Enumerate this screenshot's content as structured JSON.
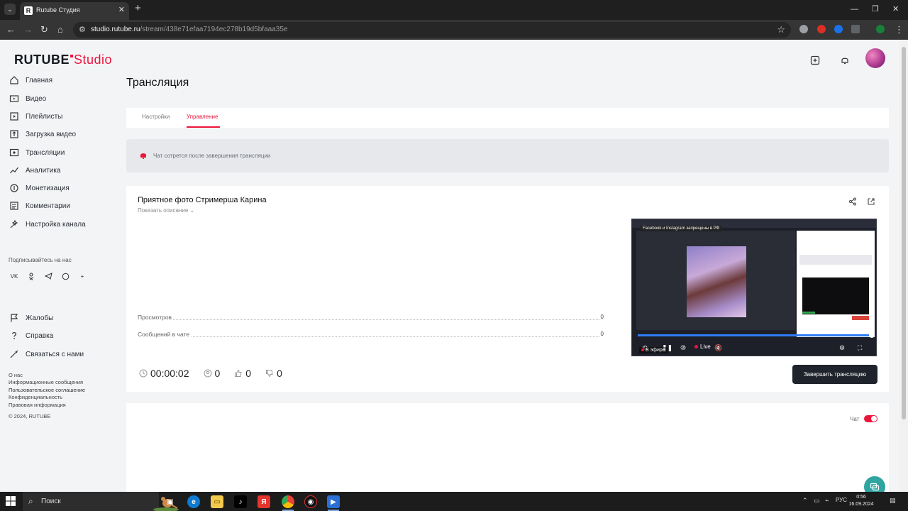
{
  "browser": {
    "tab_title": "Rutube Студия",
    "tab_favicon": "R",
    "url_host": "studio.rutube.ru",
    "url_path": "/stream/438e71efaa7194ec278b19d5bfaaa35e"
  },
  "brand": {
    "name": "RUTUBE",
    "suffix": "Studio",
    "accent": "#ed143b"
  },
  "sidebar": {
    "items": [
      {
        "label": "Главная",
        "icon": "home-icon"
      },
      {
        "label": "Видео",
        "icon": "video-icon"
      },
      {
        "label": "Плейлисты",
        "icon": "playlist-icon"
      },
      {
        "label": "Загрузка видео",
        "icon": "upload-icon"
      },
      {
        "label": "Трансляции",
        "icon": "broadcast-icon"
      },
      {
        "label": "Аналитика",
        "icon": "analytics-icon"
      },
      {
        "label": "Монетизация",
        "icon": "monetization-icon"
      },
      {
        "label": "Комментарии",
        "icon": "comments-icon"
      },
      {
        "label": "Настройка канала",
        "icon": "channel-settings-icon"
      }
    ],
    "subscribe_label": "Подписывайтесь на нас",
    "social": [
      "vk-icon",
      "ok-icon",
      "telegram-icon",
      "viber-icon",
      "more-icon"
    ],
    "help_items": [
      {
        "label": "Жалобы",
        "icon": "flag-icon"
      },
      {
        "label": "Справка",
        "icon": "help-icon"
      },
      {
        "label": "Связаться с нами",
        "icon": "contact-icon"
      }
    ],
    "footer_links": [
      "О нас",
      "Информационные сообщения",
      "Пользовательское соглашение",
      "Конфиденциальность",
      "Правовая информация"
    ],
    "copyright": "© 2024, RUTUBE"
  },
  "header": {
    "page_title": "Трансляция"
  },
  "tabs": [
    {
      "label": "Настройки",
      "active": false
    },
    {
      "label": "Управление",
      "active": true
    }
  ],
  "notice": {
    "text": "Чат сотрется после завершения трансляции"
  },
  "stream": {
    "title": "Приятное фото Стримерша Карина",
    "show_description": "Показать описание",
    "stats": [
      {
        "label": "Просмотров",
        "value": "0"
      },
      {
        "label": "Сообщений в чате",
        "value": "0"
      }
    ],
    "duration": "00:00:02",
    "viewers": "0",
    "likes": "0",
    "dislikes": "0",
    "end_button": "Завершить трансляцию"
  },
  "player": {
    "banner": "Facebook и Instagram запрещены в РФ",
    "live_label": "Live",
    "on_air_label": "В эфире",
    "progress": 1.0
  },
  "chat": {
    "label": "Чат",
    "enabled": true
  },
  "taskbar": {
    "search_label": "Поиск",
    "lang": "РУС",
    "time": "0:56",
    "date": "16.09.2024"
  }
}
